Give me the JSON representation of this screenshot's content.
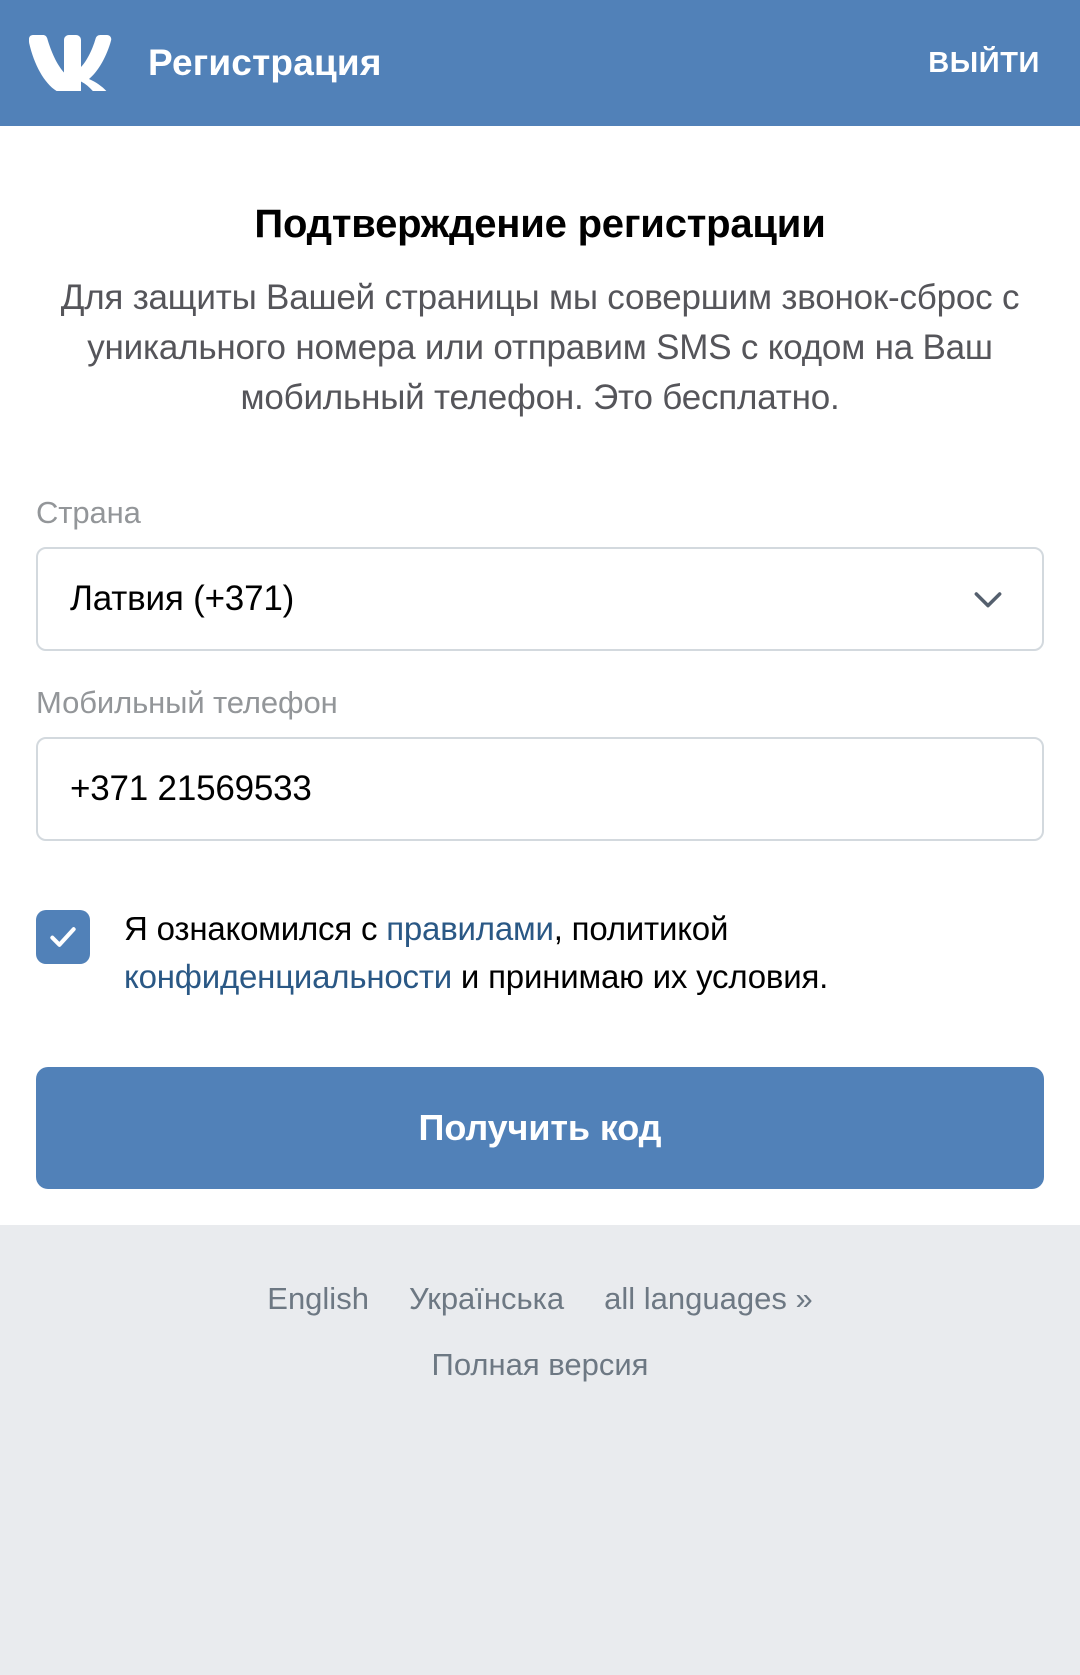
{
  "header": {
    "logo_icon": "vk-logo-icon",
    "title": "Регистрация",
    "logout_label": "выйти",
    "background_color": "#5181b8"
  },
  "main": {
    "title": "Подтверждение регистрации",
    "description": "Для защиты Вашей страницы мы совершим звонок-сброс с уникального номера или отправим SMS с кодом на Ваш мобильный телефон. Это бесплатно."
  },
  "form": {
    "country": {
      "label": "Страна",
      "value": "Латвия (+371)",
      "dropdown_icon": "chevron-down-icon"
    },
    "phone": {
      "label": "Мобильный телефон",
      "value": "+371 21569533",
      "placeholder": "+371 21569533"
    },
    "agreement": {
      "checked": true,
      "check_icon": "check-icon",
      "text_part_1": "Я ознакомился с ",
      "link_1": "правилами",
      "text_part_2": ", политикой ",
      "link_2": "конфиденциальности",
      "text_part_3": " и принимаю их условия."
    },
    "submit_label": "Получить код"
  },
  "footer": {
    "languages": [
      {
        "label": "English"
      },
      {
        "label": "Українська"
      },
      {
        "label": "all languages »"
      }
    ],
    "full_version_label": "Полная версия",
    "background_color": "#e9ebee"
  },
  "colors": {
    "brand_blue": "#5181b8",
    "link_blue": "#2a5885",
    "label_gray": "#939699",
    "body_gray": "#55555a",
    "footer_gray": "#6d7883",
    "border_gray": "#d3d9de"
  }
}
